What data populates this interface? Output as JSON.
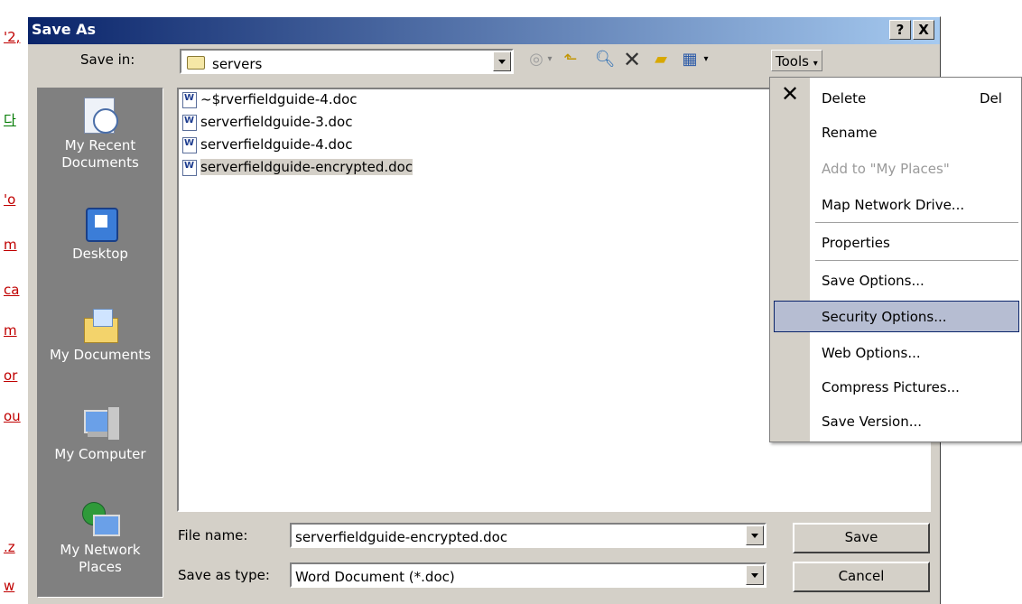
{
  "background": {
    "chars": [
      "'2,",
      "다",
      "'o",
      "m",
      "ca",
      "m",
      "or",
      "ou",
      ".z",
      "w"
    ]
  },
  "dialog": {
    "title": "Save As",
    "help_button": "?",
    "close_button": "X",
    "save_in_label": "Save in:",
    "save_in_value": "servers",
    "tools_label": "Tools",
    "places": [
      {
        "label": "My Recent Documents",
        "icon": "recent-documents-icon"
      },
      {
        "label": "Desktop",
        "icon": "desktop-icon"
      },
      {
        "label": "My Documents",
        "icon": "my-documents-icon"
      },
      {
        "label": "My Computer",
        "icon": "my-computer-icon"
      },
      {
        "label": "My Network Places",
        "icon": "network-places-icon"
      }
    ],
    "files": [
      "~$rverfieldguide-4.doc",
      "serverfieldguide-3.doc",
      "serverfieldguide-4.doc",
      "serverfieldguide-encrypted.doc"
    ],
    "selected_file_index": 3,
    "file_name_label": "File name:",
    "file_name_value": "serverfieldguide-encrypted.doc",
    "save_as_type_label": "Save as type:",
    "save_as_type_value": "Word Document (*.doc)",
    "save_button": "Save",
    "cancel_button": "Cancel"
  },
  "tools_menu": {
    "items": [
      {
        "label": "Delete",
        "shortcut": "Del",
        "enabled": true
      },
      {
        "label": "Rename",
        "enabled": true
      },
      {
        "label": "Add to \"My Places\"",
        "enabled": false
      },
      {
        "label": "Map Network Drive...",
        "enabled": true
      },
      {
        "label": "Properties",
        "enabled": true
      },
      {
        "label": "Save Options...",
        "enabled": true
      },
      {
        "label": "Security Options...",
        "enabled": true,
        "highlighted": true
      },
      {
        "label": "Web Options...",
        "enabled": true
      },
      {
        "label": "Compress Pictures...",
        "enabled": true
      },
      {
        "label": "Save Version...",
        "enabled": true
      }
    ]
  },
  "colors": {
    "titlebar_start": "#0a246a",
    "titlebar_end": "#a6caf0",
    "dialog_face": "#d4d0c8",
    "menu_highlight": "#b6bdd2"
  }
}
